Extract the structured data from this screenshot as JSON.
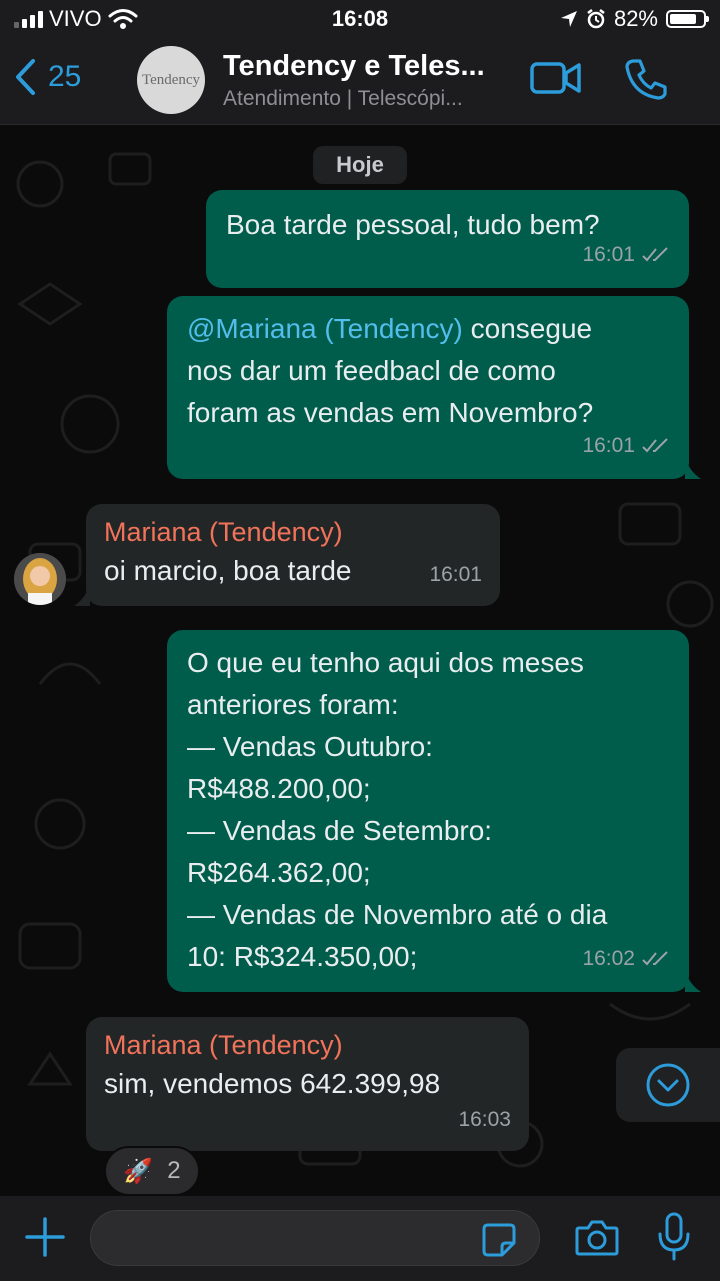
{
  "status_bar": {
    "carrier": "VIVO",
    "time": "16:08",
    "battery_pct": "82%",
    "battery_level": 0.82
  },
  "header": {
    "back_count": "25",
    "avatar_text": "Tendency",
    "title": "Tendency e Teles...",
    "subtitle": "Atendimento | Telescópi..."
  },
  "date_chip": "Hoje",
  "messages": [
    {
      "direction": "out",
      "text": "Boa tarde pessoal, tudo bem?",
      "time": "16:01"
    },
    {
      "direction": "out",
      "mention": "@Mariana (Tendency)",
      "text": " consegue\nnos dar um feedbacl de como\nforam as vendas em Novembro?",
      "time": "16:01"
    },
    {
      "direction": "in",
      "sender": "Mariana (Tendency)",
      "text": "oi marcio, boa tarde",
      "time": "16:01"
    },
    {
      "direction": "out",
      "text": "O que eu tenho aqui dos meses\nanteriores foram:\n— Vendas Outubro:\nR$488.200,00;\n— Vendas de Setembro:\nR$264.362,00;\n— Vendas de Novembro até o dia\n10: R$324.350,00;",
      "time": "16:02"
    },
    {
      "direction": "in",
      "sender": "Mariana (Tendency)",
      "text": "sim, vendemos 642.399,98",
      "time": "16:03"
    }
  ],
  "reaction": {
    "emoji": "🚀",
    "count": "2"
  },
  "colors": {
    "accent": "#2d9cdb",
    "outgoing_bubble": "#005c4b",
    "incoming_bubble": "#232627",
    "sender_name": "#f0735a",
    "mention": "#53bdeb"
  },
  "icons": [
    "back-chevron-icon",
    "video-call-icon",
    "phone-icon",
    "double-check-icon",
    "scroll-down-icon",
    "plus-icon",
    "sticker-icon",
    "camera-icon",
    "mic-icon"
  ]
}
